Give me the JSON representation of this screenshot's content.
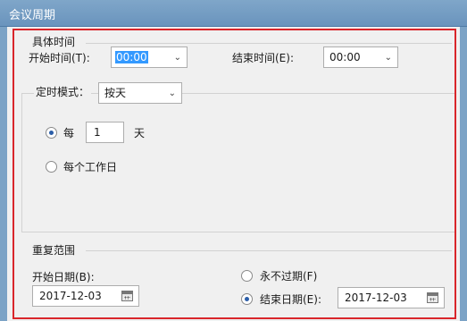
{
  "window": {
    "title": "会议周期"
  },
  "specific_time": {
    "group_title": "具体时间",
    "start_label": "开始时间(T):",
    "start_value": "00:00",
    "end_label": "结束时间(E):",
    "end_value": "00:00"
  },
  "schedule": {
    "mode_label": "定时模式：",
    "mode_value": "按天",
    "every_label": "每",
    "every_value": "1",
    "unit_label": "天",
    "every_selected": true,
    "workday_label": "每个工作日",
    "workday_selected": false
  },
  "repeat_range": {
    "group_title": "重复范围",
    "start_date_label": "开始日期(B):",
    "start_date_value": "2017-12-03",
    "never_expire_label": "永不过期(F)",
    "never_expire_selected": false,
    "end_date_label": "结束日期(E):",
    "end_date_value": "2017-12-03",
    "end_date_selected": true
  },
  "icons": {
    "dropdown": "chevron-down-icon",
    "calendar": "calendar-icon"
  },
  "colors": {
    "titlebar": "#7fa6c9",
    "highlight_border": "#d9262b",
    "radio_dot": "#2b5ea8",
    "selection": "#3399ff"
  }
}
